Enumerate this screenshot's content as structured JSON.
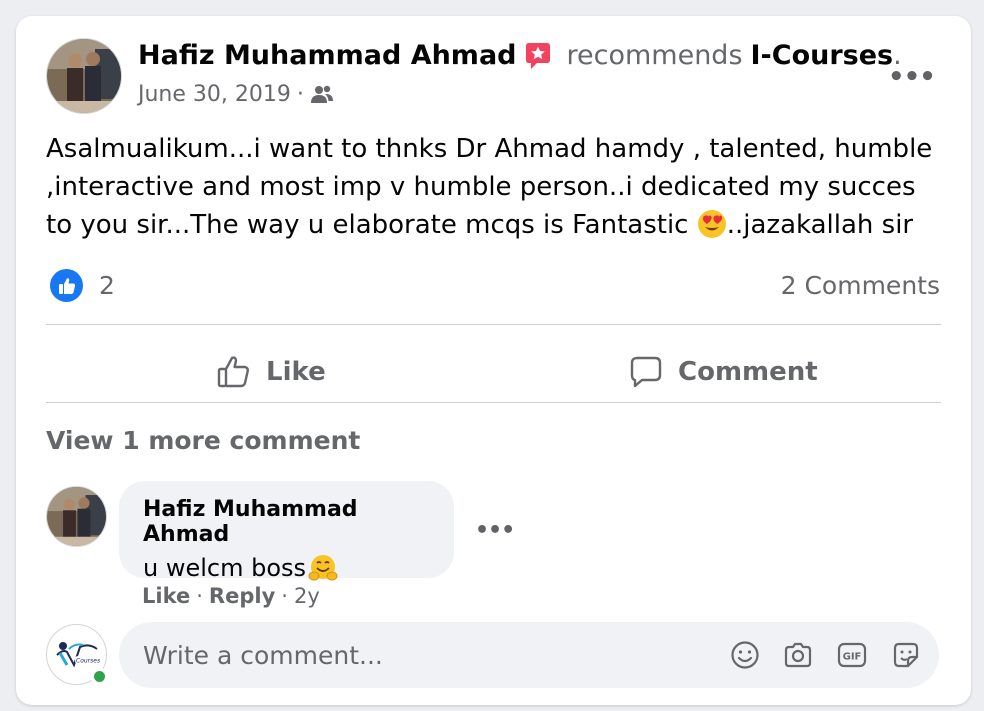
{
  "post": {
    "author": "Hafiz Muhammad Ahmad",
    "recommends_label": "recommends",
    "page_name": "I-Courses",
    "page_dot": ".",
    "date": "June 30, 2019",
    "date_sep": "·",
    "audience_icon": "friends-icon",
    "body_part1": "Asalmualikum...i want to thnks Dr Ahmad hamdy , talented, humble ,interactive and most imp v humble person..i dedicated my succes to you sir...The way u elaborate mcqs is Fantastic ",
    "body_part2": "..jazakallah sir",
    "body_emoji": "heart-eyes-emoji",
    "more_options": "•••"
  },
  "reactions": {
    "like_count": "2",
    "comments_count": "2 Comments"
  },
  "actions": {
    "like": "Like",
    "comment": "Comment"
  },
  "comments": {
    "view_more": "View 1 more comment",
    "items": [
      {
        "author": "Hafiz Muhammad Ahmad",
        "text": "u welcm boss",
        "emoji": "hugging-face-emoji",
        "like_label": "Like",
        "reply_label": "Reply",
        "sep": "·",
        "age": "2y",
        "more_options": "•••"
      }
    ]
  },
  "composer": {
    "placeholder": "Write a comment...",
    "avatar_logo_text": "I-Courses",
    "tools": [
      "emoji-icon",
      "camera-icon",
      "gif-icon",
      "sticker-icon"
    ]
  },
  "colors": {
    "accent_blue": "#1877f2",
    "secondary_text": "#65676b",
    "bubble_bg": "#f0f2f5",
    "online_green": "#31a24c",
    "badge_pink": "#f3425f"
  }
}
